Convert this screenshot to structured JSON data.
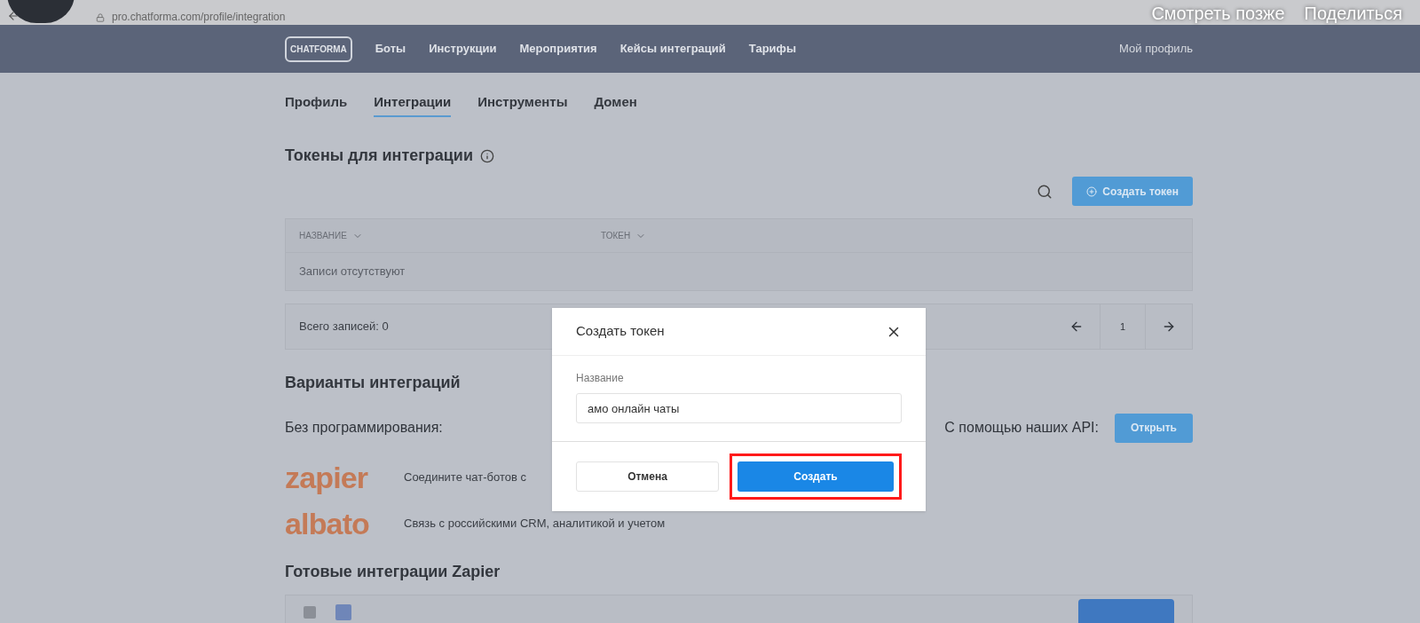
{
  "video_overlay": {
    "url": "pro.chatforma.com/profile/integration",
    "actions": [
      "Смотреть позже",
      "Поделиться"
    ]
  },
  "nav": {
    "logo": "CHATFORMA",
    "items": [
      "Боты",
      "Инструкции",
      "Мероприятия",
      "Кейсы интеграций",
      "Тарифы"
    ],
    "profile": "Мой профиль"
  },
  "tabs": [
    {
      "label": "Профиль",
      "selected": false
    },
    {
      "label": "Интеграции",
      "selected": true
    },
    {
      "label": "Инструменты",
      "selected": false
    },
    {
      "label": "Домен",
      "selected": false
    }
  ],
  "tokens": {
    "title": "Токены для интеграции",
    "create_button": "Создать токен",
    "columns": [
      "НАЗВАНИЕ",
      "ТОКЕН"
    ],
    "empty": "Записи отсутствуют",
    "total": "Всего записей: 0",
    "page": "1"
  },
  "variants": {
    "title": "Варианты интеграций",
    "no_code_label": "Без программирования:",
    "api_label": "С помощью наших API:",
    "api_button": "Открыть",
    "services": [
      {
        "logo": "zapier",
        "description": "Соедините чат-ботов с"
      },
      {
        "logo": "albato",
        "description": "Связь с российскими CRM, аналитикой и учетом"
      }
    ]
  },
  "ready": {
    "title": "Готовые интеграции Zapier"
  },
  "modal": {
    "title": "Создать токен",
    "field_label": "Название",
    "field_value": "амо онлайн чаты",
    "cancel": "Отмена",
    "submit": "Создать",
    "submit_highlighted": true
  }
}
